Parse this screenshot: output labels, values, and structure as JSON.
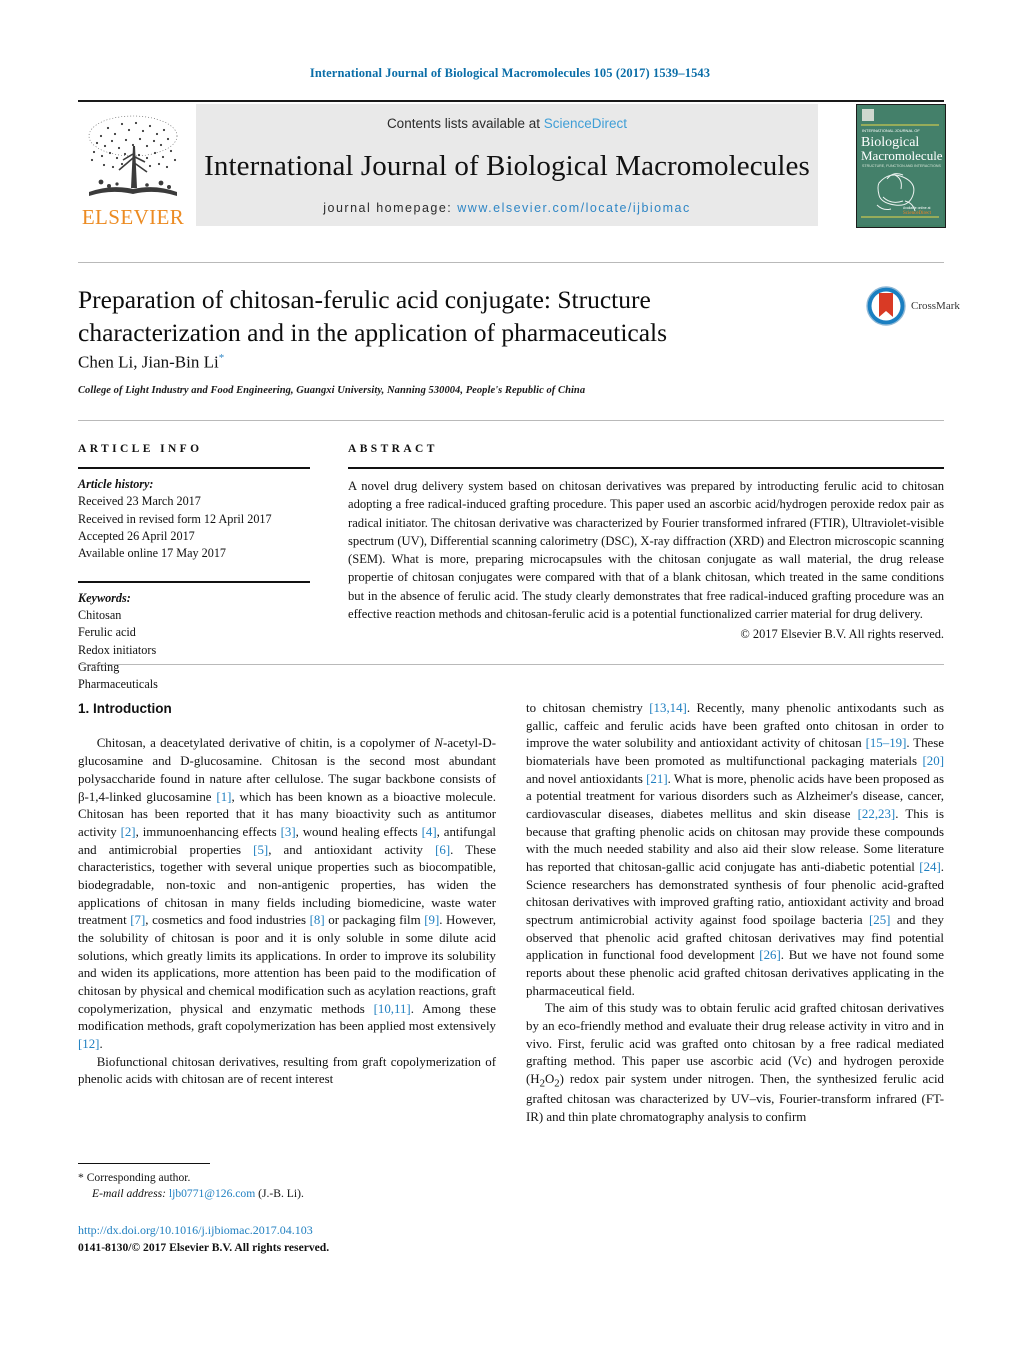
{
  "running_head": "International Journal of Biological Macromolecules 105 (2017) 1539–1543",
  "masthead": {
    "contents_prefix": "Contents lists available at ",
    "sciencedirect": "ScienceDirect",
    "journal_title": "International Journal of Biological Macromolecules",
    "homepage_label": "journal homepage: ",
    "homepage_url": "www.elsevier.com/locate/ijbiomac",
    "publisher_logo_word": "ELSEVIER",
    "cover": {
      "line1": "INTERNATIONAL JOURNAL OF",
      "line2": "Biological",
      "line3": "Macromolecules",
      "line4": "STRUCTURE, FUNCTION AND INTERACTIONS",
      "footer1": "Available online at",
      "footer2": "ScienceDirect",
      "footer3": "www.sciencedirect.com"
    }
  },
  "title": "Preparation of chitosan-ferulic acid conjugate: Structure characterization and in the application of pharmaceuticals",
  "crossmark_label": "CrossMark",
  "authors": "Chen Li, Jian-Bin Li",
  "author_marker": "*",
  "affiliation": "College of Light Industry and Food Engineering, Guangxi University, Nanning 530004, People's Republic of China",
  "article_info": {
    "heading": "ARTICLE INFO",
    "history_label": "Article history:",
    "history": [
      "Received 23 March 2017",
      "Received in revised form 12 April 2017",
      "Accepted 26 April 2017",
      "Available online 17 May 2017"
    ],
    "keywords_label": "Keywords:",
    "keywords": [
      "Chitosan",
      "Ferulic acid",
      "Redox initiators",
      "Grafting",
      "Pharmaceuticals"
    ]
  },
  "abstract": {
    "heading": "ABSTRACT",
    "text": "A novel drug delivery system based on chitosan derivatives was prepared by introducting ferulic acid to chitosan adopting a free radical-induced grafting procedure. This paper used an ascorbic acid/hydrogen peroxide redox pair as radical initiator. The chitosan derivative was characterized by Fourier transformed infrared (FTIR), Ultraviolet-visible spectrum (UV), Differential scanning calorimetry (DSC), X-ray diffraction (XRD) and Electron microscopic scanning (SEM). What is more, preparing microcapsules with the chitosan conjugate as wall material, the drug release propertie of chitosan conjugates were compared with that of a blank chitosan, which treated in the same conditions but in the absence of ferulic acid. The study clearly demonstrates that free radical-induced grafting procedure was an effective reaction methods and chitosan-ferulic acid is a potential functionalized carrier material for drug delivery.",
    "copyright": "© 2017 Elsevier B.V. All rights reserved."
  },
  "body": {
    "section_number_title": "1. Introduction",
    "left_paragraphs": [
      "Chitosan, a deacetylated derivative of chitin, is a copolymer of N-acetyl-D-glucosamine and D-glucosamine. Chitosan is the second most abundant polysaccharide found in nature after cellulose. The sugar backbone consists of β-1,4-linked glucosamine [1], which has been known as a bioactive molecule. Chitosan has been reported that it has many bioactivity such as antitumor activity [2], immunoenhancing effects [3], wound healing effects [4], antifungal and antimicrobial properties [5], and antioxidant activity [6]. These characteristics, together with several unique properties such as biocompatible, biodegradable, non-toxic and non-antigenic properties, has widen the applications of chitosan in many fields including biomedicine, waste water treatment [7], cosmetics and food industries [8] or packaging film [9]. However, the solubility of chitosan is poor and it is only soluble in some dilute acid solutions, which greatly limits its applications. In order to improve its solubility and widen its applications, more attention has been paid to the modification of chitosan by physical and chemical modification such as acylation reactions, graft copolymerization, physical and enzymatic methods [10,11]. Among these modification methods, graft copolymerization has been applied most extensively [12].",
      "Biofunctional chitosan derivatives, resulting from graft copolymerization of phenolic acids with chitosan are of recent interest"
    ],
    "right_paragraphs": [
      "to chitosan chemistry [13,14]. Recently, many phenolic antixodants such as gallic, caffeic and ferulic acids have been grafted onto chitosan in order to improve the water solubility and antioxidant activity of chitosan [15–19]. These biomaterials have been promoted as multifunctional packaging materials [20] and novel antioxidants [21]. What is more, phenolic acids have been proposed as a potential treatment for various disorders such as Alzheimer's disease, cancer, cardiovascular diseases, diabetes mellitus and skin disease [22,23]. This is because that grafting phenolic acids on chitosan may provide these compounds with the much needed stability and also aid their slow release. Some literature has reported that chitosan-gallic acid conjugate has anti-diabetic potential [24]. Science researchers has demonstrated synthesis of four phenolic acid-grafted chitosan derivatives with improved grafting ratio, antioxidant activity and broad spectrum antimicrobial activity against food spoilage bacteria [25] and they observed that phenolic acid grafted chitosan derivatives may find potential application in functional food development [26]. But we have not found some reports about these phenolic acid grafted chitosan derivatives applicating in the pharmaceutical field.",
      "The aim of this study was to obtain ferulic acid grafted chitosan derivatives by an eco-friendly method and evaluate their drug release activity in vitro and in vivo. First, ferulic acid was grafted onto chitosan by a free radical mediated grafting method. This paper use ascorbic acid (Vc) and hydrogen peroxide (H2O2) redox pair system under nitrogen. Then, the synthesized ferulic acid grafted chitosan was characterized by UV–vis, Fourier-transform infrared (FT-IR) and thin plate chromatography analysis to confirm"
    ]
  },
  "footer": {
    "corresponding_marker": "*",
    "corresponding_label": "Corresponding author.",
    "email_label": "E-mail address:",
    "email": "ljb0771@126.com",
    "email_suffix": "(J.-B. Li).",
    "doi": "http://dx.doi.org/10.1016/j.ijbiomac.2017.04.103",
    "issn_line": "0141-8130/© 2017 Elsevier B.V. All rights reserved."
  },
  "colors": {
    "link": "#1f7fc0",
    "elsevier_orange": "#ec8b22",
    "header_blue": "#0b6ea8",
    "cover_green": "#3f7e63"
  }
}
